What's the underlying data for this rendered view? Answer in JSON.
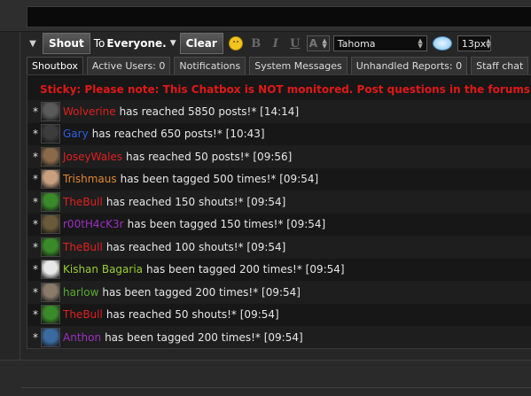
{
  "toolbar": {
    "shout_label": "Shout",
    "to_prefix": "To",
    "to_target": "Everyone.",
    "clear_label": "Clear",
    "bold_label": "B",
    "italic_label": "I",
    "underline_label": "U",
    "color_label": "A",
    "font_value": "Tahoma",
    "size_value": "13px"
  },
  "tabs": [
    {
      "label": "Shoutbox"
    },
    {
      "label": "Active Users: 0"
    },
    {
      "label": "Notifications"
    },
    {
      "label": "System Messages"
    },
    {
      "label": "Unhandled Reports: 0"
    },
    {
      "label": "Staff chat"
    }
  ],
  "sticky": "Sticky: Please note: This Chatbox is NOT monitored. Post questions in the forums.",
  "messages": [
    {
      "user": "Wolverine",
      "color": "#e02020",
      "text": "has reached 5850 posts!* [14:14]",
      "avatar": "#5a5a5a"
    },
    {
      "user": "Gary",
      "color": "#2f5fe0",
      "text": "has reached 650 posts!* [10:43]",
      "avatar": "#3c3c3c"
    },
    {
      "user": "JoseyWales",
      "color": "#e02020",
      "text": "has reached 50 posts!* [09:56]",
      "avatar": "#8a6a4a"
    },
    {
      "user": "Trishmaus",
      "color": "#e08a30",
      "text": "has been tagged 500 times!* [09:54]",
      "avatar": "#c8a080"
    },
    {
      "user": "TheBull",
      "color": "#e02020",
      "text": "has reached 150 shouts!* [09:54]",
      "avatar": "#3a8a2a"
    },
    {
      "user": "r00tH4cK3r",
      "color": "#9a30c0",
      "text": "has been tagged 150 times!* [09:54]",
      "avatar": "#6a5a3a"
    },
    {
      "user": "TheBull",
      "color": "#e02020",
      "text": "has reached 100 shouts!* [09:54]",
      "avatar": "#3a8a2a"
    },
    {
      "user": "Kishan Bagaria",
      "color": "#9acd32",
      "text": "has been tagged 200 times!* [09:54]",
      "avatar": "#e8e8e8"
    },
    {
      "user": "harlow",
      "color": "#5aaa30",
      "text": "has been tagged 200 times!* [09:54]",
      "avatar": "#8a7a6a"
    },
    {
      "user": "TheBull",
      "color": "#e02020",
      "text": "has reached 50 shouts!* [09:54]",
      "avatar": "#3a8a2a"
    },
    {
      "user": "Anthon",
      "color": "#9a30c0",
      "text": "has been tagged 200 times!* [09:54]",
      "avatar": "#3a6aa0"
    }
  ]
}
